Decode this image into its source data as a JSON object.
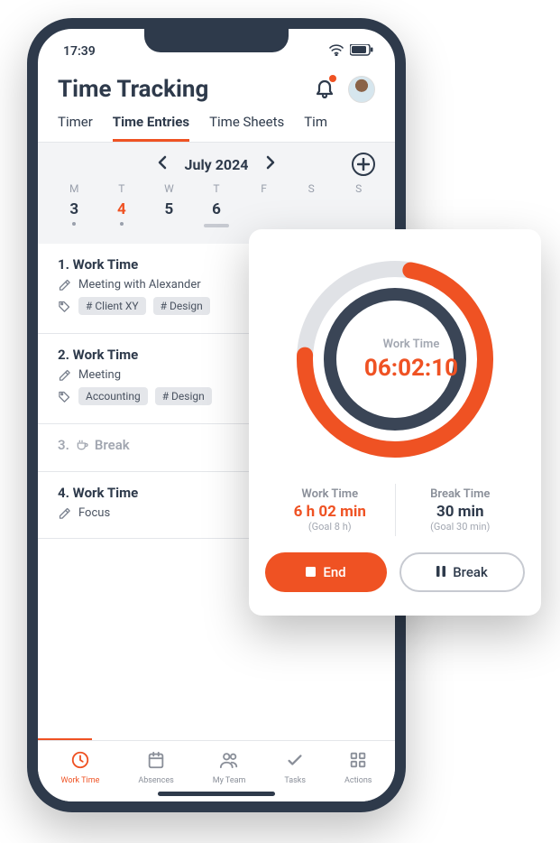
{
  "statusbar": {
    "time": "17:39"
  },
  "header": {
    "title": "Time Tracking"
  },
  "tabs": [
    "Timer",
    "Time Entries",
    "Time Sheets",
    "Tim"
  ],
  "active_tab_index": 1,
  "calendar": {
    "month_label": "July 2024",
    "weekdays": [
      "M",
      "T",
      "W",
      "T",
      "F",
      "S",
      "S"
    ],
    "days": [
      {
        "num": "3",
        "accent": false,
        "dot": true
      },
      {
        "num": "4",
        "accent": true,
        "dot": true
      },
      {
        "num": "5",
        "accent": false,
        "dot": false
      },
      {
        "num": "6",
        "accent": false,
        "dot": false,
        "selected": true
      },
      {
        "num": "",
        "accent": false,
        "dot": false
      },
      {
        "num": "",
        "accent": false,
        "dot": false
      },
      {
        "num": "",
        "accent": false,
        "dot": false
      }
    ]
  },
  "entries": [
    {
      "title": "1. Work Time",
      "note": "Meeting with Alexander",
      "tags": [
        "# Client XY",
        "# Design"
      ]
    },
    {
      "title": "2. Work Time",
      "note": "Meeting",
      "tags": [
        "Accounting",
        "# Design"
      ]
    },
    {
      "title": "3.",
      "break_label": "Break",
      "break": true
    },
    {
      "title": "4. Work Time",
      "note": "Focus"
    }
  ],
  "timer": {
    "ring_label": "Work Time",
    "ring_time": "06:02:10",
    "work": {
      "label": "Work Time",
      "value": "6 h 02 min",
      "goal": "(Goal 8 h)"
    },
    "brk": {
      "label": "Break Time",
      "value": "30 min",
      "goal": "(Goal 30 min)"
    },
    "end_label": "End",
    "break_label": "Break"
  },
  "bottomnav": [
    {
      "label": "Work Time",
      "icon": "clock",
      "active": true
    },
    {
      "label": "Absences",
      "icon": "calendar"
    },
    {
      "label": "My Team",
      "icon": "users"
    },
    {
      "label": "Tasks",
      "icon": "check"
    },
    {
      "label": "Actions",
      "icon": "grid"
    }
  ]
}
